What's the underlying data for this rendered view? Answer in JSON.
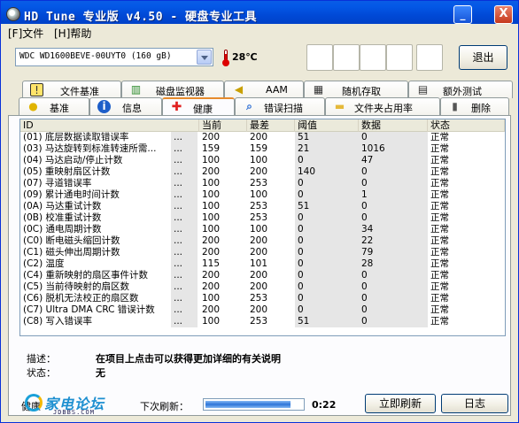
{
  "window": {
    "title": "HD Tune 专业版 v4.50 - 硬盘专业工具",
    "minimize_glyph": "_",
    "close_glyph": "X"
  },
  "menu": {
    "file": "[F]文件",
    "help": "[H]帮助"
  },
  "toolbar": {
    "drive": "WDC WD1600BEVE-00UYT0    (160 gB)",
    "temperature": "28℃",
    "exit_label": "退出"
  },
  "tabs": {
    "back": [
      {
        "label": "文件基准",
        "icon": "file-benchmark-icon",
        "glyph": "!"
      },
      {
        "label": "磁盘监视器",
        "icon": "disk-monitor-icon",
        "glyph": "▥"
      },
      {
        "label": "AAM",
        "icon": "speaker-icon",
        "glyph": "◀"
      },
      {
        "label": "随机存取",
        "icon": "random-access-icon",
        "glyph": "▦"
      },
      {
        "label": "额外测试",
        "icon": "extra-tests-icon",
        "glyph": "▤"
      }
    ],
    "front": [
      {
        "label": "基准",
        "icon": "benchmark-icon",
        "glyph": "●"
      },
      {
        "label": "信息",
        "icon": "info-icon",
        "glyph": "i"
      },
      {
        "label": "健康",
        "icon": "health-cross-icon",
        "glyph": "✚"
      },
      {
        "label": "错误扫描",
        "icon": "magnifier-icon",
        "glyph": "⌕"
      },
      {
        "label": "文件夹占用率",
        "icon": "folder-icon",
        "glyph": "▬"
      },
      {
        "label": "删除",
        "icon": "trash-icon",
        "glyph": "▮"
      }
    ],
    "active_front": "健康"
  },
  "smart": {
    "headers": {
      "id": "ID",
      "current": "当前",
      "worst": "最差",
      "threshold": "阈值",
      "data": "数据",
      "status": "状态"
    },
    "rows": [
      {
        "id": "(01) 底层数据读取错误率",
        "current": "200",
        "worst": "200",
        "threshold": "51",
        "data": "0",
        "status": "正常"
      },
      {
        "id": "(03) 马达旋转到标准转速所需...",
        "current": "159",
        "worst": "159",
        "threshold": "21",
        "data": "1016",
        "status": "正常"
      },
      {
        "id": "(04) 马达启动/停止计数",
        "current": "100",
        "worst": "100",
        "threshold": "0",
        "data": "47",
        "status": "正常"
      },
      {
        "id": "(05) 重映射扇区计数",
        "current": "200",
        "worst": "200",
        "threshold": "140",
        "data": "0",
        "status": "正常"
      },
      {
        "id": "(07) 寻道错误率",
        "current": "100",
        "worst": "253",
        "threshold": "0",
        "data": "0",
        "status": "正常"
      },
      {
        "id": "(09) 累计通电时间计数",
        "current": "100",
        "worst": "100",
        "threshold": "0",
        "data": "1",
        "status": "正常"
      },
      {
        "id": "(0A) 马达重试计数",
        "current": "100",
        "worst": "253",
        "threshold": "51",
        "data": "0",
        "status": "正常"
      },
      {
        "id": "(0B) 校准重试计数",
        "current": "100",
        "worst": "253",
        "threshold": "0",
        "data": "0",
        "status": "正常"
      },
      {
        "id": "(0C) 通电周期计数",
        "current": "100",
        "worst": "100",
        "threshold": "0",
        "data": "34",
        "status": "正常"
      },
      {
        "id": "(C0) 断电磁头缩回计数",
        "current": "200",
        "worst": "200",
        "threshold": "0",
        "data": "22",
        "status": "正常"
      },
      {
        "id": "(C1) 磁头伸出周期计数",
        "current": "200",
        "worst": "200",
        "threshold": "0",
        "data": "79",
        "status": "正常"
      },
      {
        "id": "(C2) 温度",
        "current": "115",
        "worst": "101",
        "threshold": "0",
        "data": "28",
        "status": "正常"
      },
      {
        "id": "(C4) 重新映射的扇区事件计数",
        "current": "200",
        "worst": "200",
        "threshold": "0",
        "data": "0",
        "status": "正常"
      },
      {
        "id": "(C5) 当前待映射的扇区数",
        "current": "200",
        "worst": "200",
        "threshold": "0",
        "data": "0",
        "status": "正常"
      },
      {
        "id": "(C6) 脱机无法校正的扇区数",
        "current": "100",
        "worst": "253",
        "threshold": "0",
        "data": "0",
        "status": "正常"
      },
      {
        "id": "(C7) Ultra DMA CRC 错误计数",
        "current": "200",
        "worst": "200",
        "threshold": "0",
        "data": "0",
        "status": "正常"
      },
      {
        "id": "(C8) 写入错误率",
        "current": "100",
        "worst": "253",
        "threshold": "51",
        "data": "0",
        "status": "正常"
      }
    ],
    "ellipsis": "..."
  },
  "details": {
    "desc_label": "描述：",
    "desc_text": "在项目上点击可以获得更加详细的有关说明",
    "status_label": "状态：",
    "status_text": "无"
  },
  "footer": {
    "health_label": "健康",
    "logo_text": "家电论坛",
    "logo_url": "JDBBS.COM",
    "next_refresh_label": "下次刷新：",
    "refresh_progress_percent": 88,
    "timer": "0:22",
    "refresh_now_label": "立即刷新",
    "log_label": "日志"
  }
}
